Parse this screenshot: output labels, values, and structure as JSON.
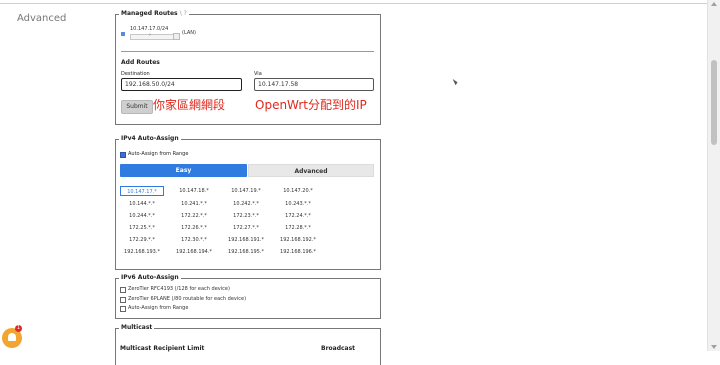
{
  "section_label": "Advanced",
  "managed_routes": {
    "legend": "Managed Routes",
    "legend_suffix": "\\ ?",
    "route": {
      "cidr": "10.147.17.0/24",
      "scope": "(LAN)"
    },
    "add_routes_title": "Add Routes",
    "destination_label": "Destination",
    "destination_value": "192.168.50.0/24",
    "via_label": "Via",
    "via_value": "10.147.17.58",
    "submit_label": "Submit",
    "annotation_left": "你家區網網段",
    "annotation_right": "OpenWrt分配到的IP"
  },
  "ipv4": {
    "legend": "IPv4 Auto-Assign",
    "checkbox_label": "Auto-Assign from Range",
    "checkbox_checked": true,
    "tabs": [
      "Easy",
      "Advanced"
    ],
    "active_tab": "Easy",
    "ranges": [
      [
        "10.147.17.*",
        "10.147.18.*",
        "10.147.19.*",
        "10.147.20.*"
      ],
      [
        "10.144.*.*",
        "10.241.*.*",
        "10.242.*.*",
        "10.243.*.*"
      ],
      [
        "10.244.*.*",
        "172.22.*.*",
        "172.23.*.*",
        "172.24.*.*"
      ],
      [
        "172.25.*.*",
        "172.26.*.*",
        "172.27.*.*",
        "172.28.*.*"
      ],
      [
        "172.29.*.*",
        "172.30.*.*",
        "192.168.191.*",
        "192.168.192.*"
      ],
      [
        "192.168.193.*",
        "192.168.194.*",
        "192.168.195.*",
        "192.168.196.*"
      ]
    ],
    "selected_range": "10.147.17.*"
  },
  "ipv6": {
    "legend": "IPv6 Auto-Assign",
    "options": [
      "ZeroTier RFC4193 (/128 for each device)",
      "ZeroTier 6PLANE (/80 routable for each device)",
      "Auto-Assign from Range"
    ]
  },
  "multicast": {
    "legend": "Multicast",
    "recipient_limit_label": "Multicast Recipient Limit",
    "broadcast_label": "Broadcast"
  },
  "notification": {
    "badge_count": "1"
  },
  "colors": {
    "accent": "#2f7be0",
    "annotation": "#e0281d",
    "notification": "#f2a531"
  }
}
